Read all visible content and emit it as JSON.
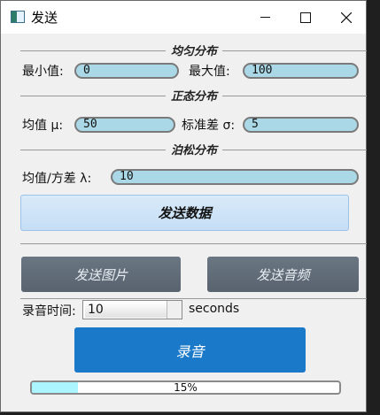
{
  "window": {
    "title": "发送",
    "minimize_label": "—",
    "maximize_label": "□",
    "close_label": "✕"
  },
  "uniform": {
    "section_label": "均匀分布",
    "min_label": "最小值:",
    "min_value": "0",
    "max_label": "最大值:",
    "max_value": "100"
  },
  "normal": {
    "section_label": "正态分布",
    "mean_label": "均值 μ:",
    "mean_value": "50",
    "std_label": "标准差 σ:",
    "std_value": "5"
  },
  "poisson": {
    "section_label": "泊松分布",
    "lambda_label": "均值/方差 λ:",
    "lambda_value": "10"
  },
  "buttons": {
    "send_data": "发送数据",
    "send_image": "发送图片",
    "send_audio": "发送音频",
    "record": "录音"
  },
  "recording": {
    "time_label": "录音时间:",
    "time_value": "10",
    "unit_label": "seconds"
  },
  "progress": {
    "value": 15,
    "text": "15%"
  }
}
